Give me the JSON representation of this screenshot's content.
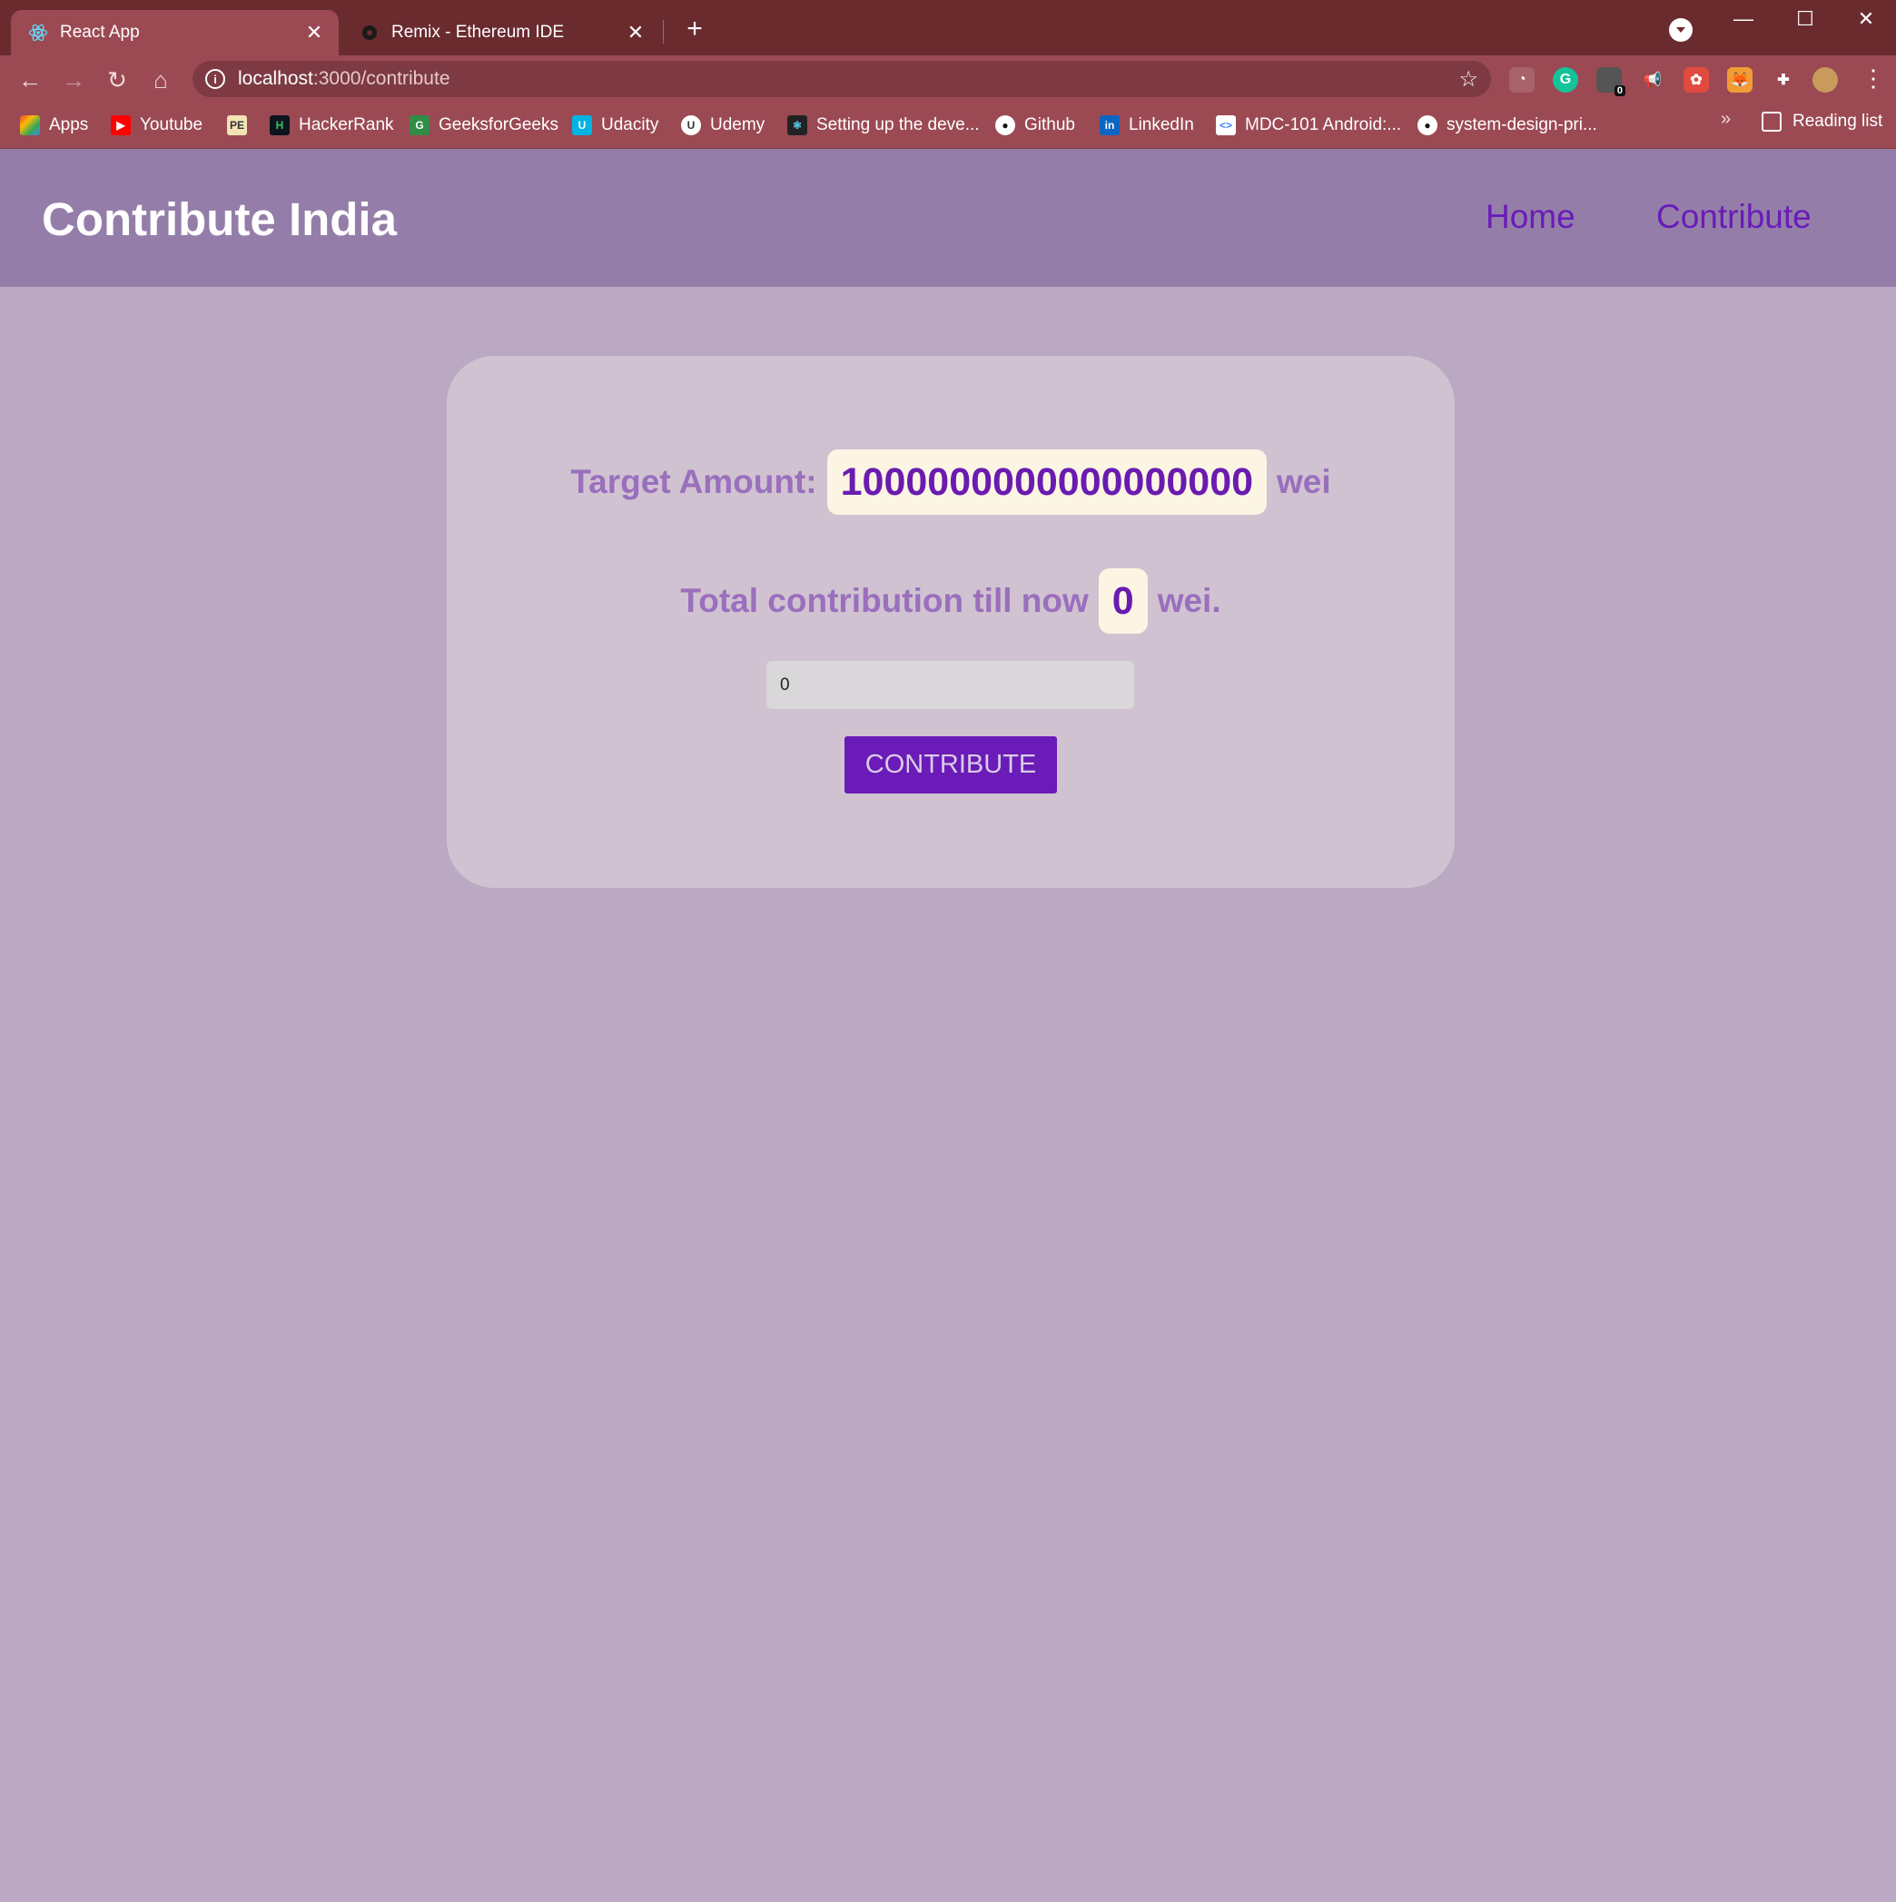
{
  "browser": {
    "tabs": [
      {
        "title": "React App",
        "favicon": "react-icon",
        "active": true
      },
      {
        "title": "Remix - Ethereum IDE",
        "favicon": "remix-icon",
        "active": false
      }
    ],
    "new_tab": "+",
    "url_host": "localhost",
    "url_path": ":3000/contribute",
    "bookmarks": [
      {
        "label": "Apps",
        "icon": "apps-grid-icon"
      },
      {
        "label": "Youtube",
        "icon": "youtube-icon"
      },
      {
        "label": "",
        "icon": "pe-icon"
      },
      {
        "label": "HackerRank",
        "icon": "hackerrank-icon"
      },
      {
        "label": "GeeksforGeeks",
        "icon": "geeksforgeeks-icon"
      },
      {
        "label": "Udacity",
        "icon": "udacity-icon"
      },
      {
        "label": "Udemy",
        "icon": "udemy-icon"
      },
      {
        "label": "Setting up the deve...",
        "icon": "react-icon"
      },
      {
        "label": "Github",
        "icon": "github-icon"
      },
      {
        "label": "LinkedIn",
        "icon": "linkedin-icon"
      },
      {
        "label": "MDC-101 Android:...",
        "icon": "codelabs-icon"
      },
      {
        "label": "system-design-pri...",
        "icon": "github-icon"
      }
    ],
    "more_bookmarks": "»",
    "reading_list": "Reading list",
    "extension_badge": "0"
  },
  "app": {
    "brand": "Contribute India",
    "nav": [
      "Home",
      "Contribute"
    ],
    "target_label": "Target Amount:",
    "target_value": "1000000000000000000",
    "unit": "wei",
    "total_label": "Total contribution till now",
    "total_value": "0",
    "total_unit": "wei.",
    "input_value": "0",
    "button_label": "CONTRIBUTE"
  },
  "colors": {
    "nav_bg": "#947ea9",
    "page_bg": "#bba8c3",
    "card_bg": "#d0c2d1",
    "accent": "#6a1bb8",
    "label": "#9a6fbd",
    "pill_bg": "#fcf5e4"
  }
}
